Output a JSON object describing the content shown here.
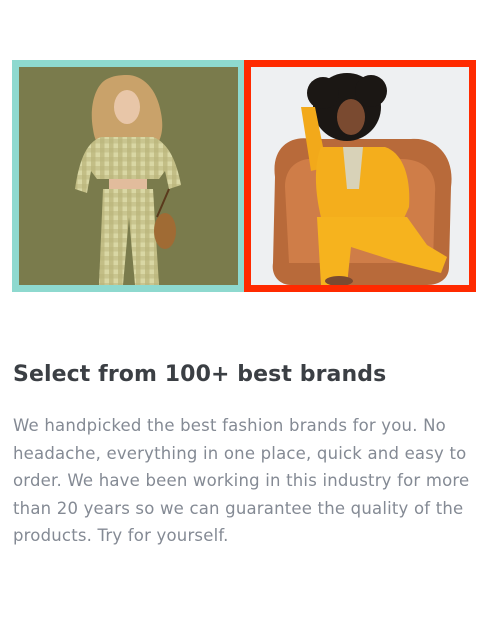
{
  "feature": {
    "title": "Select from 100+ best brands",
    "description": "We handpicked the best fashion brands for you. No headache, everything in one place, quick and easy to order. We have been working in this industry for more than 20 years so we can guarantee the quality of the products. Try for yourself."
  },
  "images": [
    {
      "name": "model-checkered-outfit-photo",
      "frame_color": "#8ed9cf"
    },
    {
      "name": "model-yellow-suit-photo",
      "frame_color": "#ff2a00"
    }
  ],
  "colors": {
    "heading": "#3b3f44",
    "body_text": "#848a94",
    "background": "#ffffff"
  }
}
